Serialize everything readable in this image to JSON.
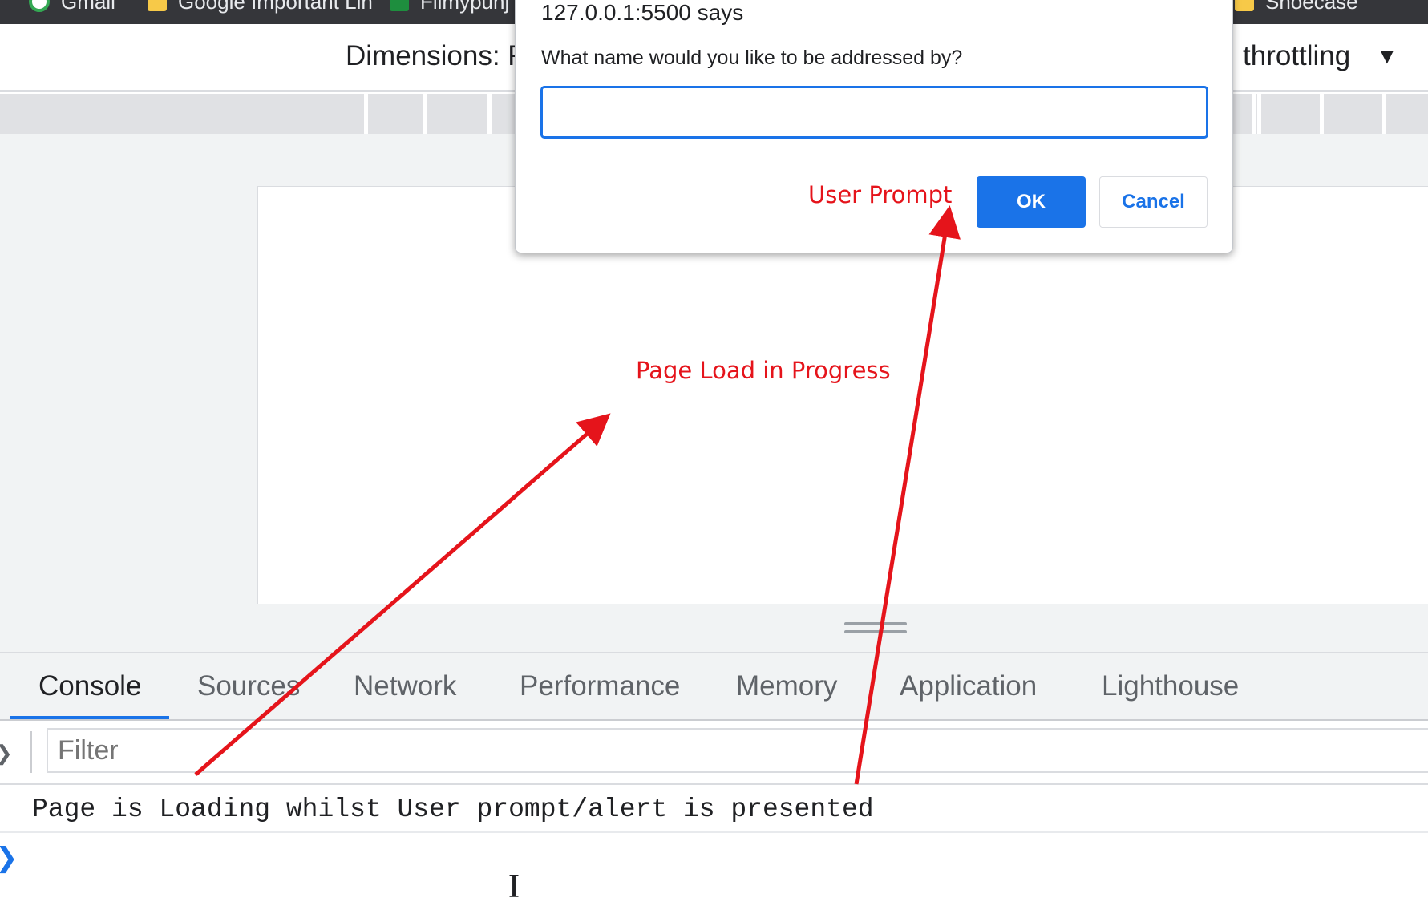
{
  "bookmarks": [
    {
      "label": "Gmail",
      "icon": "google-circle-icon"
    },
    {
      "label": "Google Important Lin",
      "icon": "folder-icon"
    },
    {
      "label": "Filmypunj",
      "icon": "meet-icon"
    },
    {
      "label": "Shoecase",
      "icon": "folder-icon"
    }
  ],
  "device_toolbar": {
    "dimensions_label": "Dimensions: R",
    "throttling_label": "throttling",
    "dropdown_arrow": "▼"
  },
  "devtools": {
    "tabs": [
      {
        "label": "Console",
        "active": true
      },
      {
        "label": "Sources",
        "active": false
      },
      {
        "label": "Network",
        "active": false
      },
      {
        "label": "Performance",
        "active": false
      },
      {
        "label": "Memory",
        "active": false
      },
      {
        "label": "Application",
        "active": false
      },
      {
        "label": "Lighthouse",
        "active": false
      }
    ],
    "filter_placeholder": "Filter",
    "console_message": "Page is Loading whilst User prompt/alert is presented",
    "prompt_symbol": "❯",
    "sidebar_toggle": "❯"
  },
  "dialog": {
    "title": "127.0.0.1:5500 says",
    "message": "What name would you like to be addressed by?",
    "input_value": "",
    "ok_label": "OK",
    "cancel_label": "Cancel"
  },
  "annotations": {
    "user_prompt": "User Prompt",
    "page_load": "Page Load in Progress",
    "color": "#e5141b"
  },
  "colors": {
    "accent": "#1a73e8",
    "annotation": "#e5141b",
    "bookmarks_bar": "#35363a"
  }
}
